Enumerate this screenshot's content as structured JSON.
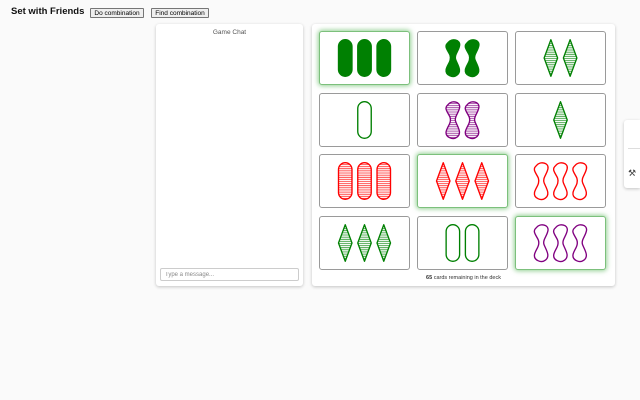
{
  "app": {
    "title": "Set with Friends",
    "do_combination_label": "Do combination",
    "find_combination_label": "Find combination"
  },
  "chat": {
    "header": "Game Chat",
    "input_placeholder": "Type a message..."
  },
  "board": {
    "deck_remaining": "65",
    "deck_suffix": "cards remaining in the deck",
    "cards": [
      {
        "count": 3,
        "shape": "oval",
        "color": "green",
        "shading": "solid",
        "selected": true
      },
      {
        "count": 2,
        "shape": "squiggle",
        "color": "green",
        "shading": "solid",
        "selected": false
      },
      {
        "count": 2,
        "shape": "diamond",
        "color": "green",
        "shading": "striped",
        "selected": false
      },
      {
        "count": 1,
        "shape": "oval",
        "color": "green",
        "shading": "empty",
        "selected": false
      },
      {
        "count": 2,
        "shape": "squiggle",
        "color": "purple",
        "shading": "striped",
        "selected": false
      },
      {
        "count": 1,
        "shape": "diamond",
        "color": "green",
        "shading": "striped",
        "selected": false
      },
      {
        "count": 3,
        "shape": "oval",
        "color": "red",
        "shading": "striped",
        "selected": false
      },
      {
        "count": 3,
        "shape": "diamond",
        "color": "red",
        "shading": "striped",
        "selected": true
      },
      {
        "count": 3,
        "shape": "squiggle",
        "color": "red",
        "shading": "empty",
        "selected": false
      },
      {
        "count": 3,
        "shape": "diamond",
        "color": "green",
        "shading": "striped",
        "selected": false
      },
      {
        "count": 2,
        "shape": "oval",
        "color": "green",
        "shading": "empty",
        "selected": false
      },
      {
        "count": 3,
        "shape": "squiggle",
        "color": "purple",
        "shading": "empty",
        "selected": true
      }
    ]
  },
  "colors": {
    "green": "#008002",
    "red": "#ff0101",
    "purple": "#800080",
    "selected_glow": "#3caa3c"
  },
  "icons": {
    "side_tab": "tool-icon"
  }
}
